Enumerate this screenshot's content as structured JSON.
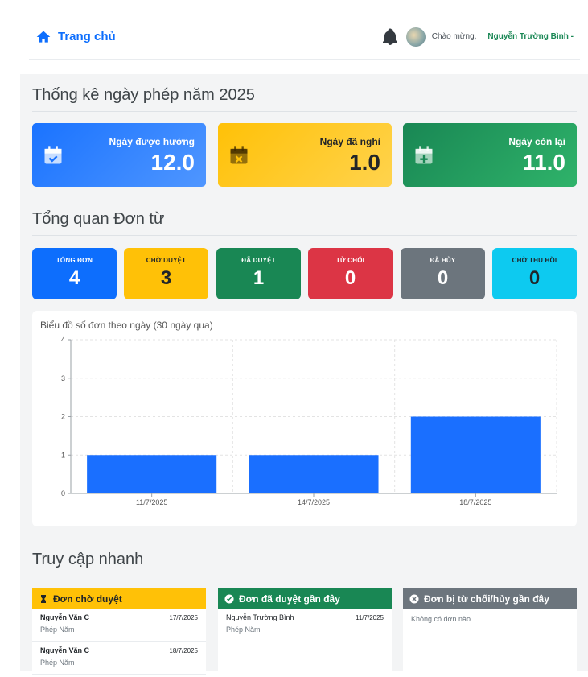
{
  "header": {
    "home_label": "Trang chủ",
    "greeting": "Chào mừng,",
    "user_name": "Nguyễn Trường Bình -"
  },
  "leave_stats": {
    "title": "Thống kê ngày phép năm 2025",
    "cards": [
      {
        "label": "Ngày được hưởng",
        "value": "12.0",
        "icon": "calendar-check-icon",
        "color": "#1a73ff"
      },
      {
        "label": "Ngày đã nghỉ",
        "value": "1.0",
        "icon": "calendar-x-icon",
        "color": "#ffc107"
      },
      {
        "label": "Ngày còn lại",
        "value": "11.0",
        "icon": "calendar-plus-icon",
        "color": "#198754"
      }
    ]
  },
  "requests_overview": {
    "title": "Tổng quan Đơn từ",
    "pills": [
      {
        "label": "TỔNG ĐƠN",
        "value": "4",
        "color": "#0d6efd"
      },
      {
        "label": "CHỜ DUYỆT",
        "value": "3",
        "color": "#ffc107"
      },
      {
        "label": "ĐÃ DUYỆT",
        "value": "1",
        "color": "#198754"
      },
      {
        "label": "TỪ CHỐI",
        "value": "0",
        "color": "#dc3545"
      },
      {
        "label": "ĐÃ HỦY",
        "value": "0",
        "color": "#6c757d"
      },
      {
        "label": "CHỜ THU HỒI",
        "value": "0",
        "color": "#0dcaf0"
      }
    ]
  },
  "chart_data": {
    "type": "bar",
    "title": "Biểu đồ số đơn theo ngày (30 ngày qua)",
    "categories": [
      "11/7/2025",
      "14/7/2025",
      "18/7/2025"
    ],
    "values": [
      1,
      1,
      2
    ],
    "ylim": [
      0,
      4
    ],
    "yticks": [
      "0",
      "1",
      "2",
      "3",
      "4"
    ],
    "grid": true,
    "bar_color": "#1a6fff"
  },
  "quick_access": {
    "title": "Truy cập nhanh",
    "pending": {
      "title": "Đơn chờ duyệt",
      "items": [
        {
          "name": "Nguyễn Văn C",
          "date": "17/7/2025",
          "type": "Phép Năm"
        },
        {
          "name": "Nguyễn Văn C",
          "date": "18/7/2025",
          "type": "Phép Năm"
        }
      ]
    },
    "approved": {
      "title": "Đơn đã duyệt gần đây",
      "items": [
        {
          "name": "Nguyễn Trường Bình",
          "date": "11/7/2025",
          "type": "Phép Năm"
        }
      ]
    },
    "rejected": {
      "title": "Đơn bị từ chối/hủy gần đây",
      "empty_text": "Không có đơn nào."
    }
  }
}
